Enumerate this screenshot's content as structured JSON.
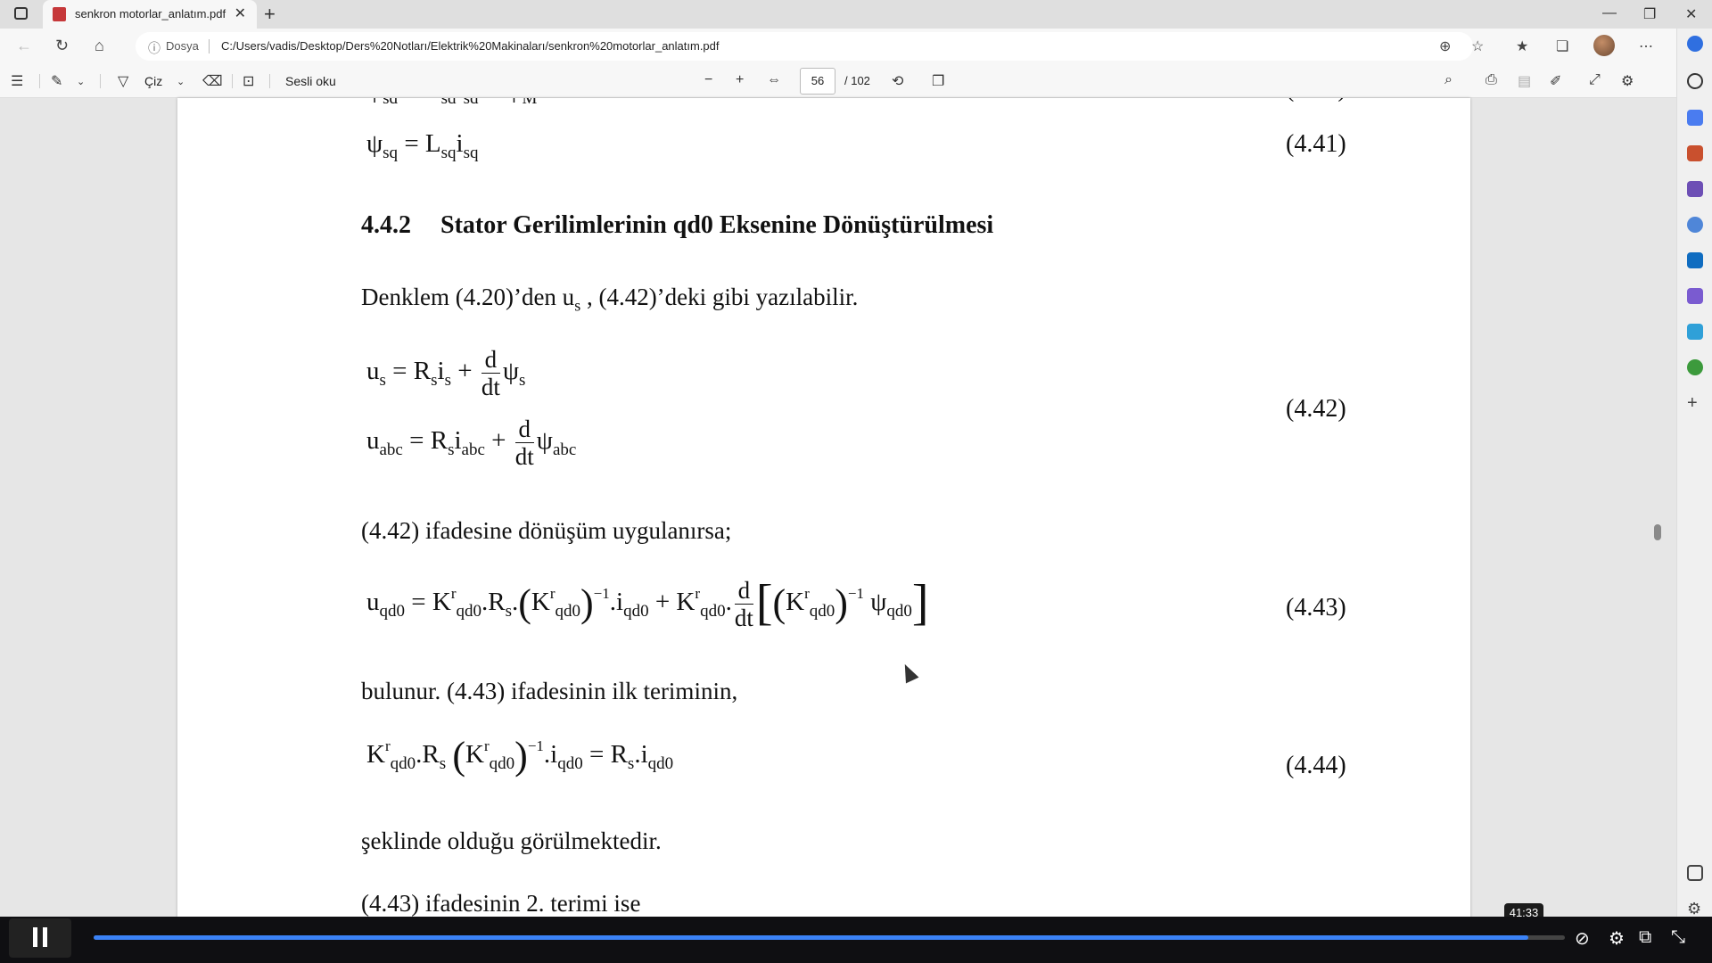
{
  "browser": {
    "tab_title": "senkron motorlar_anlatım.pdf",
    "address_label": "Dosya",
    "url": "C:/Users/vadis/Desktop/Ders%20Notları/Elektrik%20Makinaları/senkron%20motorlar_anlatım.pdf"
  },
  "pdf_toolbar": {
    "draw_label": "Çiz",
    "read_aloud_label": "Sesli oku",
    "page_current": "56",
    "page_total": "/ 102"
  },
  "document": {
    "eq_4_41_num": "(4.41)",
    "heading_number": "4.4.2",
    "heading_text": "Stator Gerilimlerinin qd0 Eksenine Dönüştürülmesi",
    "para1_a": "Denklem (4.20)’den u",
    "para1_sub": "s",
    "para1_b": " , (4.42)’deki gibi yazılabilir.",
    "eq_4_42_num": "(4.42)",
    "para2": "(4.42)  ifadesine dönüşüm uygulanırsa;",
    "eq_4_43_num": "(4.43)",
    "para3": "bulunur. (4.43) ifadesinin ilk teriminin,",
    "eq_4_44_num": "(4.44)",
    "para4": "şeklinde olduğu görülmektedir.",
    "para5": "(4.43) ifadesinin 2. terimi ise"
  },
  "video": {
    "timestamp": "41:33",
    "progress": 0.975
  },
  "colors": {
    "accent": "#3b82f6",
    "pdf_red": "#c6383a"
  }
}
